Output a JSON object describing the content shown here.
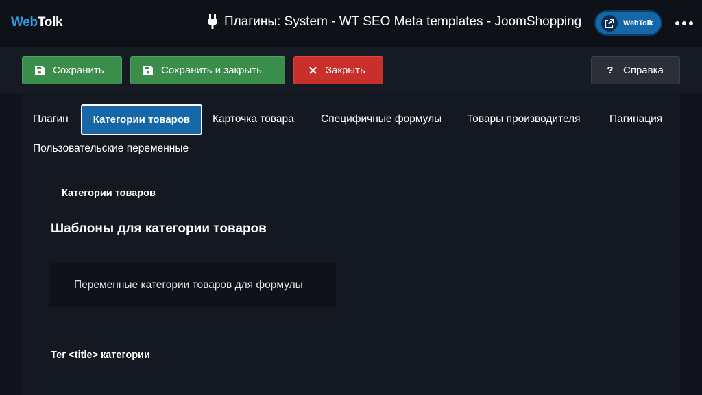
{
  "header": {
    "logo_part1": "Web",
    "logo_part2": "Tolk",
    "title": "Плагины: System - WT SEO Meta templates - JoomShopping",
    "title_icon": "plug-icon",
    "site_button_label": "WebTolk",
    "site_button_icon": "external-link-icon",
    "menu_icon": "more-dots-icon"
  },
  "toolbar": {
    "save_label": "Сохранить",
    "save_close_label": "Сохранить и закрыть",
    "close_label": "Закрыть",
    "help_label": "Справка",
    "colors": {
      "save": "#3a8d4b",
      "close": "#c9302c",
      "help": "#2a2f38"
    }
  },
  "tabs": [
    {
      "label": "Плагин",
      "active": false
    },
    {
      "label": "Категории товаров",
      "active": true
    },
    {
      "label": "Карточка товара",
      "active": false
    },
    {
      "label": "Специфичные формулы",
      "active": false
    },
    {
      "label": "Товары производителя",
      "active": false
    },
    {
      "label": "Пагинация",
      "active": false
    },
    {
      "label": "Пользовательские переменные",
      "active": false
    }
  ],
  "content": {
    "section_tag": "Категории товаров",
    "section_title": "Шаблоны для категории товаров",
    "vars_button": "Переменные категории товаров для формулы",
    "field_label": "Тег <title> категории"
  },
  "accent_color": "#1567a7"
}
